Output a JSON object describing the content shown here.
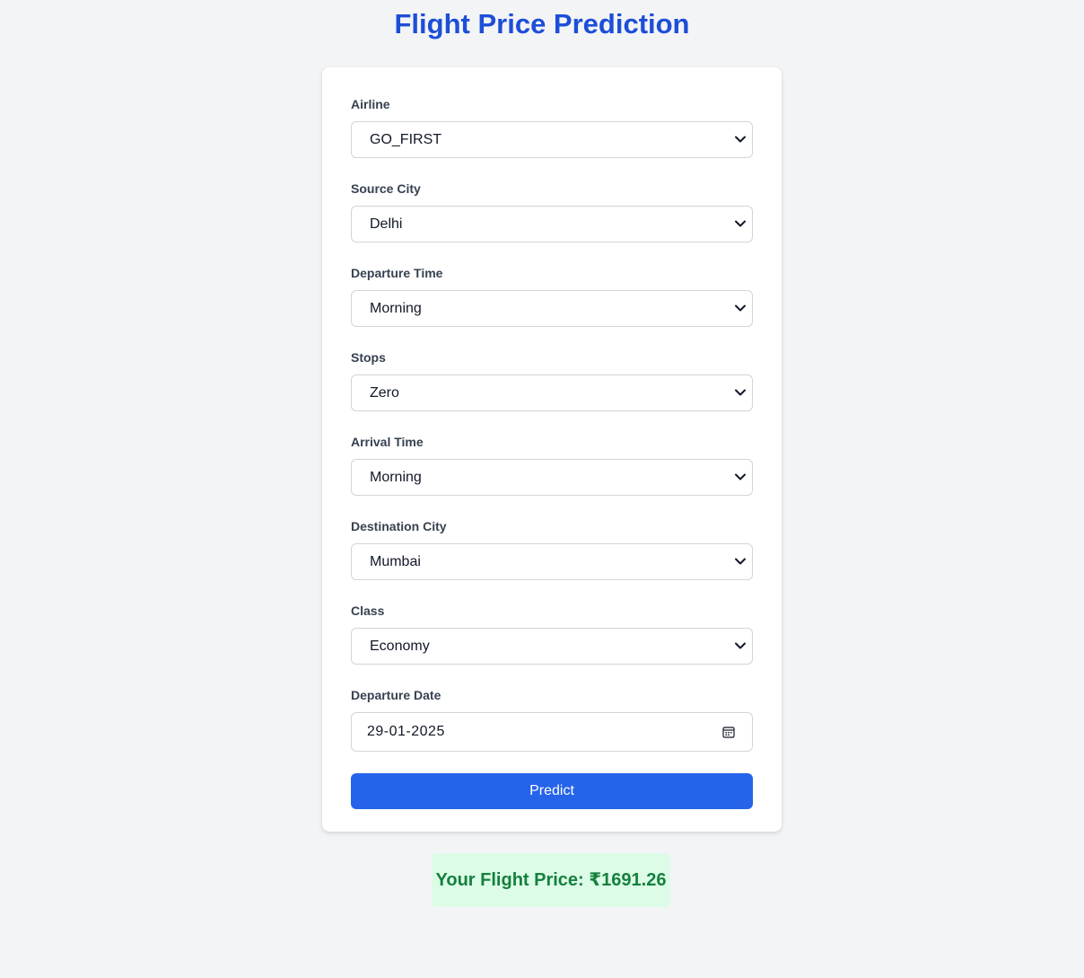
{
  "page": {
    "title": "Flight Price Prediction"
  },
  "form": {
    "fields": [
      {
        "label": "Airline",
        "value": "GO_FIRST"
      },
      {
        "label": "Source City",
        "value": "Delhi"
      },
      {
        "label": "Departure Time",
        "value": "Morning"
      },
      {
        "label": "Stops",
        "value": "Zero"
      },
      {
        "label": "Arrival Time",
        "value": "Morning"
      },
      {
        "label": "Destination City",
        "value": "Mumbai"
      },
      {
        "label": "Class",
        "value": "Economy"
      }
    ],
    "departure_date": {
      "label": "Departure Date",
      "value": "29-01-2025"
    },
    "submit_label": "Predict"
  },
  "result": {
    "text": "Your Flight Price: ₹1691.26"
  },
  "colors": {
    "title": "#1d4ed8",
    "button": "#2563eb",
    "result_bg": "#dcfce7",
    "result_text": "#15803d",
    "page_bg": "#f3f4f6"
  },
  "icons": {
    "select": "chevron-down-icon",
    "date": "calendar-icon"
  }
}
